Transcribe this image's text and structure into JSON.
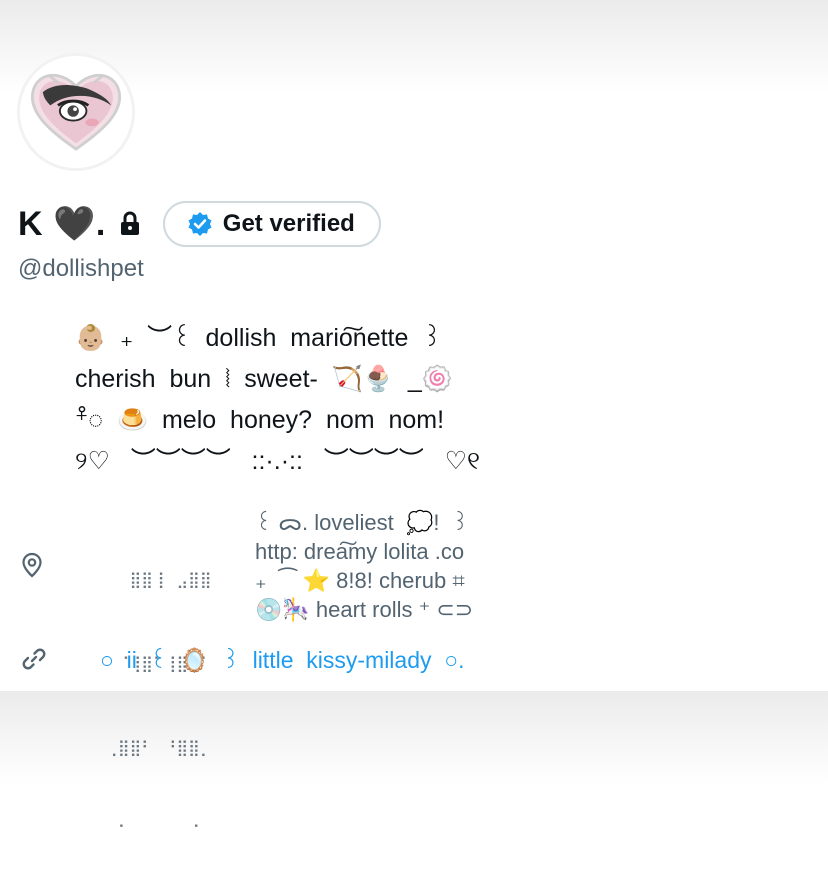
{
  "profile": {
    "display_name": "K 🖤.",
    "handle": "@dollishpet",
    "verify_button_label": "Get verified",
    "bio_lines": [
      "👶🏼  ₊  ︶꒰  dollish  mario͠nette  ꒱",
      "cherish  bun  ⦚  sweet-  🏹🍨  _🍥",
      "⁺̊◌  🍮  melo  honey?  nom  nom!",
      "୨♡   ︶︶︶︶   ::·.·::   ︶︶︶︶   ♡୧"
    ],
    "location_art": [
      "⠀⠀⣿⣿⢸⠀⣠⣿⣿",
      "⠀⠈⢸⣿⠁⢸⣿⠁⠁",
      "⢀⣿⣿⠃⠀⠘⣿⣿⡀",
      "⠀⠁⠀⠀⠀⠀⠀⠈⠀"
    ],
    "location_lines": [
      "꒰ ᯅ. loveliest  💭!  ꒱",
      "http: drea͠my lolita .co",
      "₊  ⁀ ⭐ 8!8! cherub ⌗",
      "💿🎠 heart rolls ⁺ ⊂⊃"
    ],
    "website": "○  ii  ꒰  🪞  ꒱  little  kissy-milady  ○.",
    "icons": {
      "lock": "lock-icon",
      "verified_badge": "verified-badge-icon",
      "location": "location-pin-icon",
      "link": "link-icon"
    }
  },
  "colors": {
    "text_primary": "#0f1419",
    "text_secondary": "#536471",
    "link": "#1d9bf0",
    "verified_blue": "#1d9bf0",
    "button_border": "#cfd9de"
  }
}
